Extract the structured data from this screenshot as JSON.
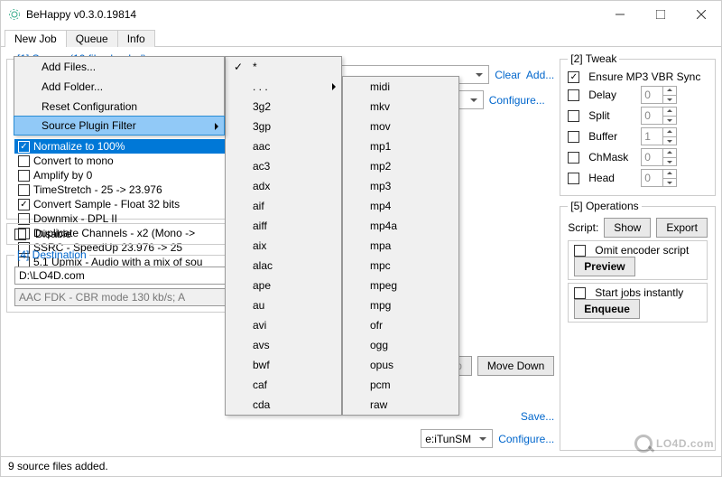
{
  "window": {
    "title": "BeHappy v0.3.0.19814"
  },
  "tabs": [
    "New Job",
    "Queue",
    "Info"
  ],
  "source": {
    "legend": "[1] Source  (10 files loaded)",
    "menu": {
      "items": [
        "Add Files...",
        "Add Folder...",
        "Reset Configuration",
        "Source Plugin Filter"
      ],
      "active_index": 3
    },
    "dsp_items": [
      {
        "label": "Normalize to 100%",
        "checked": true,
        "selected": true
      },
      {
        "label": "Convert to mono",
        "checked": false
      },
      {
        "label": "Amplify by 0",
        "checked": false
      },
      {
        "label": "TimeStretch - 25 -> 23.976",
        "checked": false
      },
      {
        "label": "Convert Sample - Float 32 bits",
        "checked": true
      },
      {
        "label": "Downmix - DPL II",
        "checked": false
      },
      {
        "label": "Duplicate Channels - x2 (Mono ->",
        "checked": false
      },
      {
        "label": "SSRC - SpeedUp 23.976 -> 25",
        "checked": false
      },
      {
        "label": "5.1 Upmix - Audio with a mix of sou",
        "checked": false
      }
    ],
    "disable_label": "Disable"
  },
  "ext_submenu": {
    "first": "*",
    "more": ". . .",
    "col1": [
      "3g2",
      "3gp",
      "aac",
      "ac3",
      "adx",
      "aif",
      "aiff",
      "aix",
      "alac",
      "ape",
      "au",
      "avi",
      "avs",
      "bwf",
      "caf",
      "cda"
    ],
    "col2": [
      "midi",
      "mkv",
      "mov",
      "mp1",
      "mp2",
      "mp3",
      "mp4",
      "mp4a",
      "mpa",
      "mpc",
      "mpeg",
      "mpg",
      "ofr",
      "ogg",
      "opus",
      "pcm",
      "raw"
    ]
  },
  "midcol": {
    "clear": "Clear",
    "add": "Add...",
    "configure": "Configure...",
    "moveup": "Move Up",
    "movedown": "Move Down",
    "save": "Save...",
    "itunsm": "e:iTunSM"
  },
  "dest": {
    "legend": "[4] Destination",
    "path": "D:\\LO4D.com",
    "codec": "AAC FDK - CBR mode 130 kb/s; A"
  },
  "tweak": {
    "legend": "[2] Tweak",
    "ensure": "Ensure MP3 VBR Sync",
    "rows": [
      {
        "label": "Delay",
        "value": "0"
      },
      {
        "label": "Split",
        "value": "0"
      },
      {
        "label": "Buffer",
        "value": "1"
      },
      {
        "label": "ChMask",
        "value": "0"
      },
      {
        "label": "Head",
        "value": "0"
      }
    ]
  },
  "ops": {
    "legend": "[5] Operations",
    "script_label": "Script:",
    "show": "Show",
    "export": "Export",
    "omit": "Omit encoder script",
    "preview": "Preview",
    "startjobs": "Start jobs instantly",
    "enqueue": "Enqueue"
  },
  "status": "9 source files added.",
  "watermark": "LO4D.com"
}
